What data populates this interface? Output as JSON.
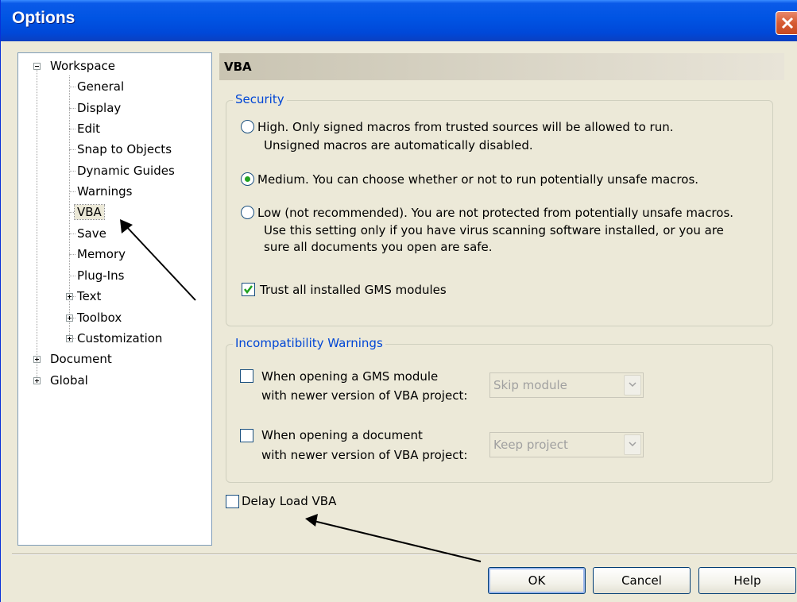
{
  "window": {
    "title": "Options"
  },
  "tree": {
    "items": [
      {
        "label": "Workspace",
        "expander": "minus"
      },
      {
        "label": "General"
      },
      {
        "label": "Display"
      },
      {
        "label": "Edit"
      },
      {
        "label": "Snap to Objects"
      },
      {
        "label": "Dynamic Guides"
      },
      {
        "label": "Warnings"
      },
      {
        "label": "VBA",
        "selected": true
      },
      {
        "label": "Save"
      },
      {
        "label": "Memory"
      },
      {
        "label": "Plug-Ins"
      },
      {
        "label": "Text",
        "expander": "plus"
      },
      {
        "label": "Toolbox",
        "expander": "plus"
      },
      {
        "label": "Customization",
        "expander": "plus"
      },
      {
        "label": "Document",
        "expander": "plus"
      },
      {
        "label": "Global",
        "expander": "plus"
      }
    ]
  },
  "page": {
    "title": "VBA",
    "security": {
      "title": "Security",
      "high_line1": "High. Only signed macros from trusted sources will be allowed to run.",
      "high_line2": "Unsigned macros are automatically disabled.",
      "medium": "Medium. You can choose whether or not to run potentially unsafe macros.",
      "low_line1": "Low (not recommended). You are not protected from potentially unsafe macros.",
      "low_line2": "Use this setting only if you have virus scanning software installed, or you are",
      "low_line3": "sure all documents you open are safe.",
      "selected": "medium",
      "trust_label": "Trust all installed GMS modules",
      "trust_checked": true
    },
    "incompat": {
      "title": "Incompatibility Warnings",
      "gms_line1": "When opening a GMS module",
      "gms_line2": "with newer version of VBA project:",
      "gms_checked": false,
      "gms_select": "Skip module",
      "doc_line1": "When opening a document",
      "doc_line2": "with newer version of VBA project:",
      "doc_checked": false,
      "doc_select": "Keep project"
    },
    "delay_label": "Delay Load VBA",
    "delay_checked": false
  },
  "buttons": {
    "ok": "OK",
    "cancel": "Cancel",
    "help": "Help"
  },
  "colors": {
    "titlebar": "#0054e3",
    "group_title": "#0046d5",
    "radio_dot": "#21a121",
    "check": "#21a121"
  }
}
